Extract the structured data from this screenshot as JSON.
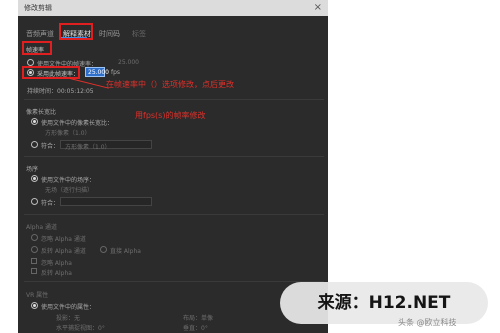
{
  "dialog": {
    "title": "修改剪辑",
    "tabs": [
      "音频声道",
      "解释素材",
      "时间码",
      "标签"
    ]
  },
  "frame_rate": {
    "section_label": "帧速率",
    "option_file": "使用文件中的帧速率：",
    "option_file_value": "25.000",
    "option_assume": "采用此帧速率：",
    "fps_value": "25.000",
    "fps_unit": "fps",
    "duration_label": "持续时间：00:05:12:05"
  },
  "annotations": {
    "main": "在帧速率中（）选项修改，点后更改",
    "secondary": "用fps(s)的帧率修改"
  },
  "pixel_aspect": {
    "section_label": "像素长宽比",
    "option_file": "使用文件中的像素长宽比：",
    "option_file_sub": "方形像素（1.0）",
    "option_assume": "符合：",
    "option_assume_value": "方形像素（1.0）"
  },
  "field_order": {
    "section_label": "场序",
    "option_file": "使用文件中的场序：",
    "option_file_sub": "无场（逐行扫描）",
    "option_assume": "符合："
  },
  "alpha": {
    "section_label": "Alpha 通道",
    "option_1": "忽略 Alpha 通道",
    "option_2": "反转 Alpha 通道",
    "option_3": "直接 Alpha",
    "option_4": "预乘 Alpha",
    "check_1": "忽略 Alpha",
    "check_2": "反转 Alpha"
  },
  "vr": {
    "section_label": "VR 属性",
    "option_file": "使用文件中的属性：",
    "projection": "投影：无",
    "layout": "布局：单像",
    "h_view": "水平捕捉视图：0°",
    "v_view": "垂直：0°"
  },
  "watermark": {
    "text": "来源：H12.NET",
    "subtext": "头条 @欧立科技"
  }
}
